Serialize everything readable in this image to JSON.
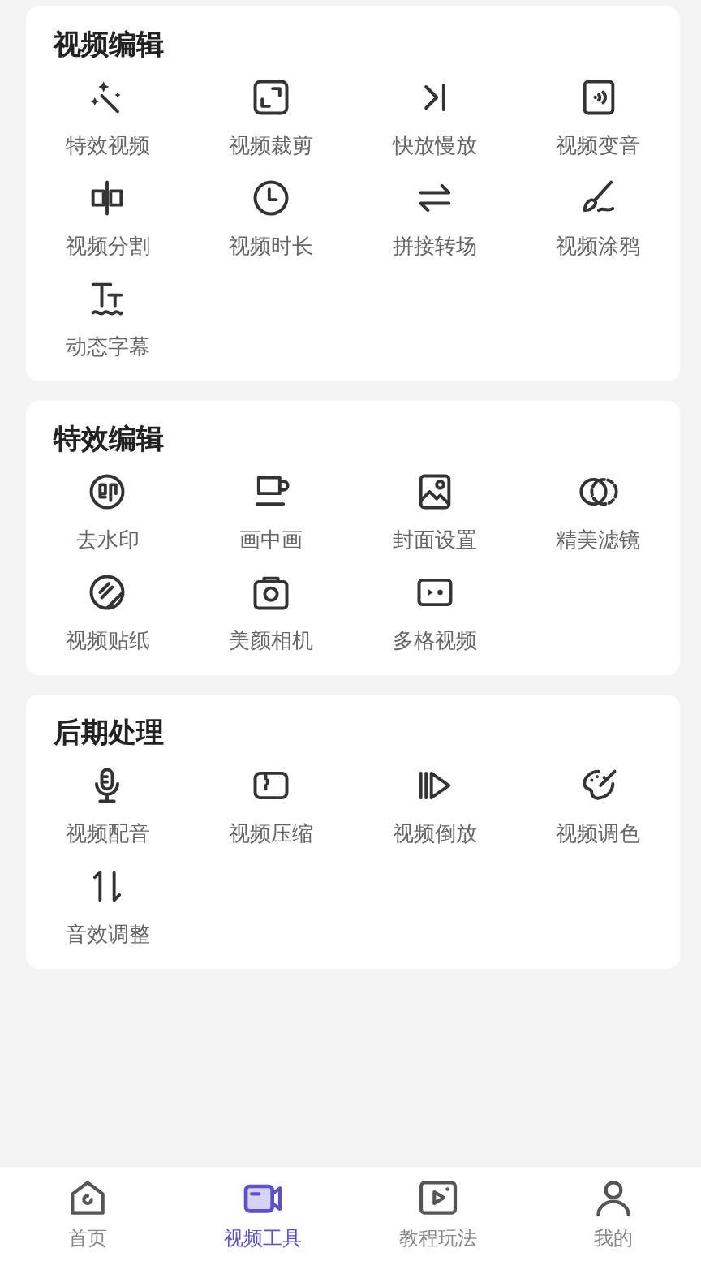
{
  "sections": [
    {
      "title": "视频编辑",
      "items": [
        {
          "label": "特效视频"
        },
        {
          "label": "视频裁剪"
        },
        {
          "label": "快放慢放"
        },
        {
          "label": "视频变音"
        },
        {
          "label": "视频分割"
        },
        {
          "label": "视频时长"
        },
        {
          "label": "拼接转场"
        },
        {
          "label": "视频涂鸦"
        },
        {
          "label": "动态字幕"
        }
      ]
    },
    {
      "title": "特效编辑",
      "items": [
        {
          "label": "去水印"
        },
        {
          "label": "画中画"
        },
        {
          "label": "封面设置"
        },
        {
          "label": "精美滤镜"
        },
        {
          "label": "视频贴纸"
        },
        {
          "label": "美颜相机"
        },
        {
          "label": "多格视频"
        }
      ]
    },
    {
      "title": "后期处理",
      "items": [
        {
          "label": "视频配音"
        },
        {
          "label": "视频压缩"
        },
        {
          "label": "视频倒放"
        },
        {
          "label": "视频调色"
        },
        {
          "label": "音效调整"
        }
      ]
    }
  ],
  "nav": [
    {
      "label": "首页",
      "selected": false
    },
    {
      "label": "视频工具",
      "selected": true
    },
    {
      "label": "教程玩法",
      "selected": false
    },
    {
      "label": "我的",
      "selected": false
    }
  ]
}
